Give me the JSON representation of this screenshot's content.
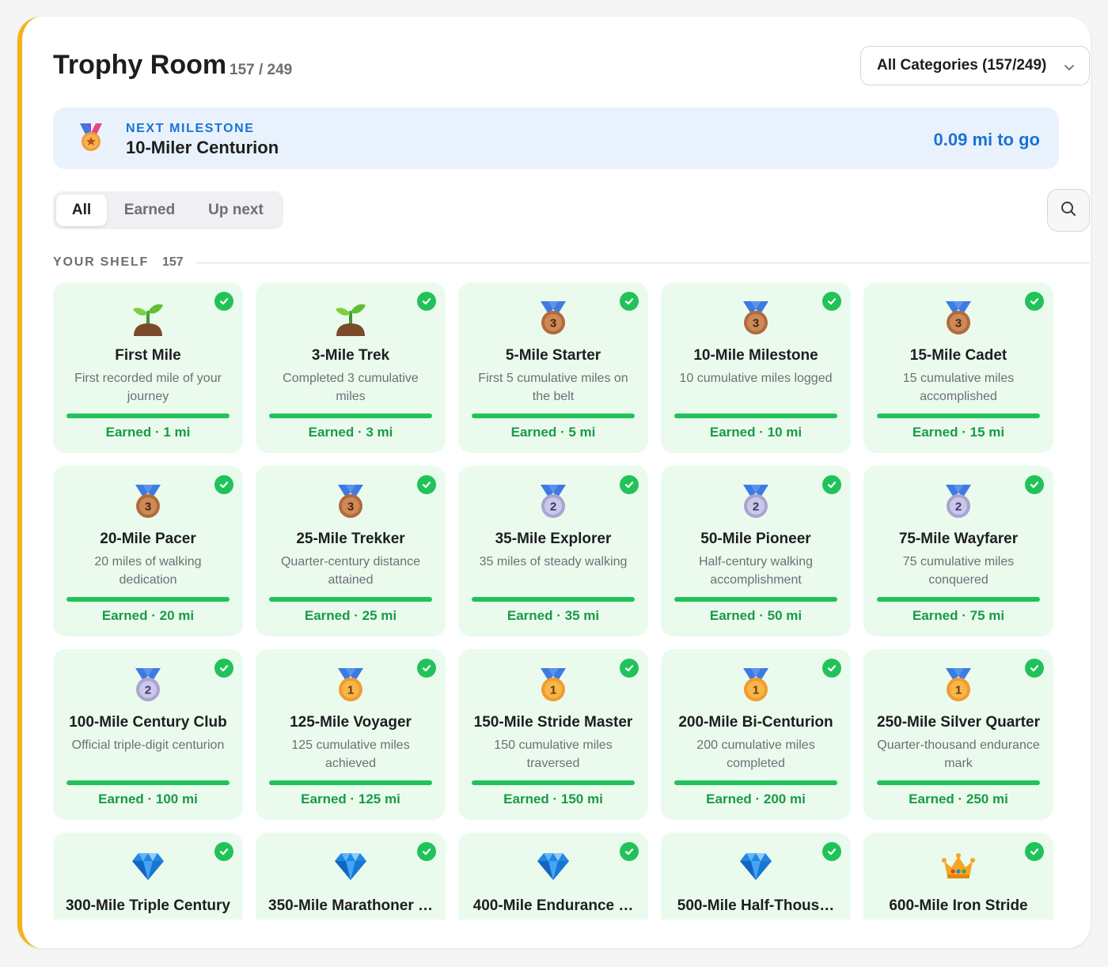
{
  "header": {
    "title": "Trophy Room",
    "count": "157 / 249",
    "category_select": "All Categories (157/249)"
  },
  "milestone": {
    "label": "NEXT MILESTONE",
    "name": "10-Miler Centurion",
    "to_go": "0.09 mi to go"
  },
  "tabs": [
    {
      "label": "All",
      "active": true
    },
    {
      "label": "Earned",
      "active": false
    },
    {
      "label": "Up next",
      "active": false
    }
  ],
  "shelf": {
    "label": "YOUR SHELF",
    "count": "157"
  },
  "colors": {
    "accent_stripe": "#f2b315",
    "blue": "#1b72d6",
    "green": "#22c25a",
    "card_bg": "#eafbee"
  },
  "cards": [
    {
      "icon": "sprout-icon",
      "name": "First Mile",
      "desc": "First recorded mile of your journey",
      "status": "Earned · 1 mi"
    },
    {
      "icon": "sprout-icon",
      "name": "3-Mile Trek",
      "desc": "Completed 3 cumulative miles",
      "status": "Earned · 3 mi"
    },
    {
      "icon": "bronze-medal-icon",
      "name": "5-Mile Starter",
      "desc": "First 5 cumulative miles on the belt",
      "status": "Earned · 5 mi"
    },
    {
      "icon": "bronze-medal-icon",
      "name": "10-Mile Milestone",
      "desc": "10 cumulative miles logged",
      "status": "Earned · 10 mi"
    },
    {
      "icon": "bronze-medal-icon",
      "name": "15-Mile Cadet",
      "desc": "15 cumulative miles accomplished",
      "status": "Earned · 15 mi"
    },
    {
      "icon": "bronze-medal-icon",
      "name": "20-Mile Pacer",
      "desc": "20 miles of walking dedication",
      "status": "Earned · 20 mi"
    },
    {
      "icon": "bronze-medal-icon",
      "name": "25-Mile Trekker",
      "desc": "Quarter-century distance attained",
      "status": "Earned · 25 mi"
    },
    {
      "icon": "silver-medal-icon",
      "name": "35-Mile Explorer",
      "desc": "35 miles of steady walking",
      "status": "Earned · 35 mi"
    },
    {
      "icon": "silver-medal-icon",
      "name": "50-Mile Pioneer",
      "desc": "Half-century walking accomplishment",
      "status": "Earned · 50 mi"
    },
    {
      "icon": "silver-medal-icon",
      "name": "75-Mile Wayfarer",
      "desc": "75 cumulative miles conquered",
      "status": "Earned · 75 mi"
    },
    {
      "icon": "silver-medal-icon",
      "name": "100-Mile Century Club",
      "desc": "Official triple-digit centurion",
      "status": "Earned · 100 mi"
    },
    {
      "icon": "gold-medal-icon",
      "name": "125-Mile Voyager",
      "desc": "125 cumulative miles achieved",
      "status": "Earned · 125 mi"
    },
    {
      "icon": "gold-medal-icon",
      "name": "150-Mile Stride Master",
      "desc": "150 cumulative miles traversed",
      "status": "Earned · 150 mi"
    },
    {
      "icon": "gold-medal-icon",
      "name": "200-Mile Bi-Centurion",
      "desc": "200 cumulative miles completed",
      "status": "Earned · 200 mi"
    },
    {
      "icon": "gold-medal-icon",
      "name": "250-Mile Silver Quarter",
      "desc": "Quarter-thousand endurance mark",
      "status": "Earned · 250 mi"
    },
    {
      "icon": "gem-icon",
      "name": "300-Mile Triple Century",
      "desc": "",
      "status": ""
    },
    {
      "icon": "gem-icon",
      "name": "350-Mile Marathoner …",
      "desc": "",
      "status": ""
    },
    {
      "icon": "gem-icon",
      "name": "400-Mile Endurance …",
      "desc": "",
      "status": ""
    },
    {
      "icon": "gem-icon",
      "name": "500-Mile Half-Thous…",
      "desc": "",
      "status": ""
    },
    {
      "icon": "crown-icon",
      "name": "600-Mile Iron Stride",
      "desc": "",
      "status": ""
    }
  ]
}
